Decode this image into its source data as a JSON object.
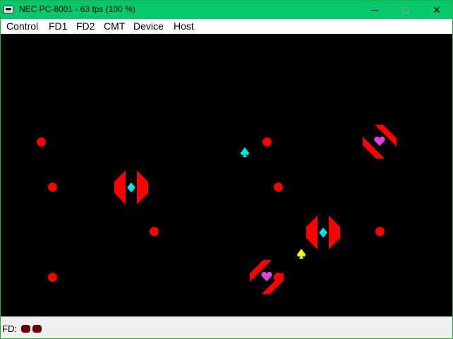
{
  "window": {
    "title": "NEC PC-8001 - 63 fps (100 %)",
    "controls": {
      "minimize": "minimize-icon",
      "maximize": "maximize-icon",
      "close": "✕"
    }
  },
  "menubar": {
    "items": [
      {
        "label": "Control"
      },
      {
        "label": "FD1"
      },
      {
        "label": "FD2"
      },
      {
        "label": "CMT"
      },
      {
        "label": "Device"
      },
      {
        "label": "Host"
      }
    ]
  },
  "screen": {
    "background": "#000000",
    "colors": {
      "dot": "#ff0000",
      "ship": "#ff0000",
      "cyan": "#00e5e5",
      "magenta": "#e040e0",
      "yellow": "#ffff00"
    }
  },
  "statusbar": {
    "fd_label": "FD:",
    "drives": [
      {
        "name": "drive-1-led",
        "color": "#6e0000"
      },
      {
        "name": "drive-2-led",
        "color": "#6e0000"
      }
    ]
  }
}
